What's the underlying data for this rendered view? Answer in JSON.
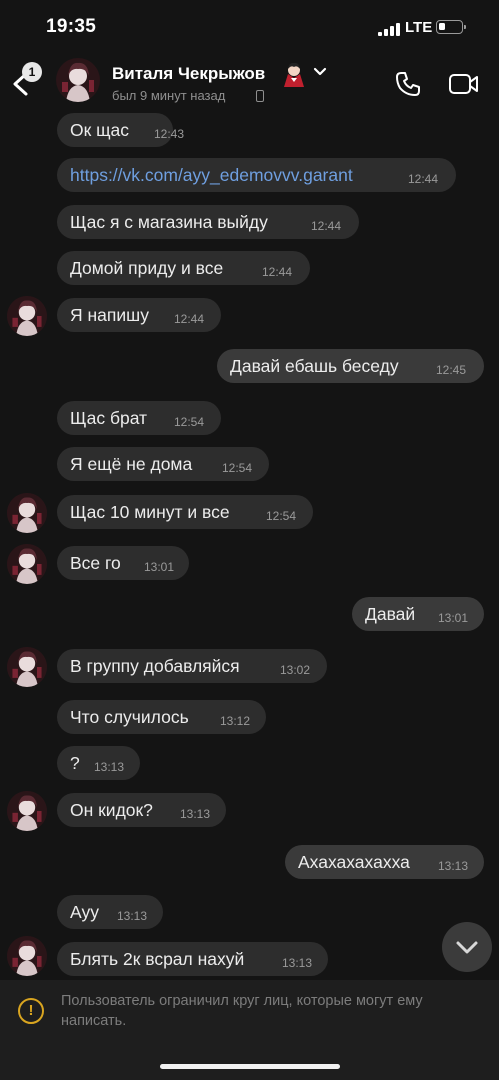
{
  "status_bar": {
    "time": "19:35",
    "network": "LTE"
  },
  "header": {
    "unread_count": "1",
    "name": "Виталя Чекрыжов",
    "status": "был 9 минут назад"
  },
  "messages": [
    {
      "dir": "in",
      "text": "Ок щас",
      "time": "12:43"
    },
    {
      "dir": "in",
      "text": "https://vk.com/ayy_edemovvv.garant",
      "time": "12:44"
    },
    {
      "dir": "in",
      "text": "Щас я с магазина выйду",
      "time": "12:44"
    },
    {
      "dir": "in",
      "text": "Домой приду и все",
      "time": "12:44"
    },
    {
      "dir": "in",
      "text": "Я напишу",
      "time": "12:44"
    },
    {
      "dir": "out",
      "text": "Давай ебашь беседу",
      "time": "12:45"
    },
    {
      "dir": "in",
      "text": "Щас брат",
      "time": "12:54"
    },
    {
      "dir": "in",
      "text": "Я ещё не дома",
      "time": "12:54"
    },
    {
      "dir": "in",
      "text": "Щас 10 минут и все",
      "time": "12:54"
    },
    {
      "dir": "in",
      "text": "Все го",
      "time": "13:01"
    },
    {
      "dir": "out",
      "text": "Давай",
      "time": "13:01"
    },
    {
      "dir": "in",
      "text": "В группу добавляйся",
      "time": "13:02"
    },
    {
      "dir": "in",
      "text": "Что случилось",
      "time": "13:12"
    },
    {
      "dir": "in",
      "text": "?",
      "time": "13:13"
    },
    {
      "dir": "in",
      "text": "Он кидок?",
      "time": "13:13"
    },
    {
      "dir": "out",
      "text": "Ахахахахахха",
      "time": "13:13"
    },
    {
      "dir": "in",
      "text": "Ауу",
      "time": "13:13"
    },
    {
      "dir": "in",
      "text": "Блять 2к всрал нахуй",
      "time": "13:13"
    }
  ],
  "restriction": {
    "text": "Пользователь ограничил круг лиц, которые могут ему написать."
  }
}
